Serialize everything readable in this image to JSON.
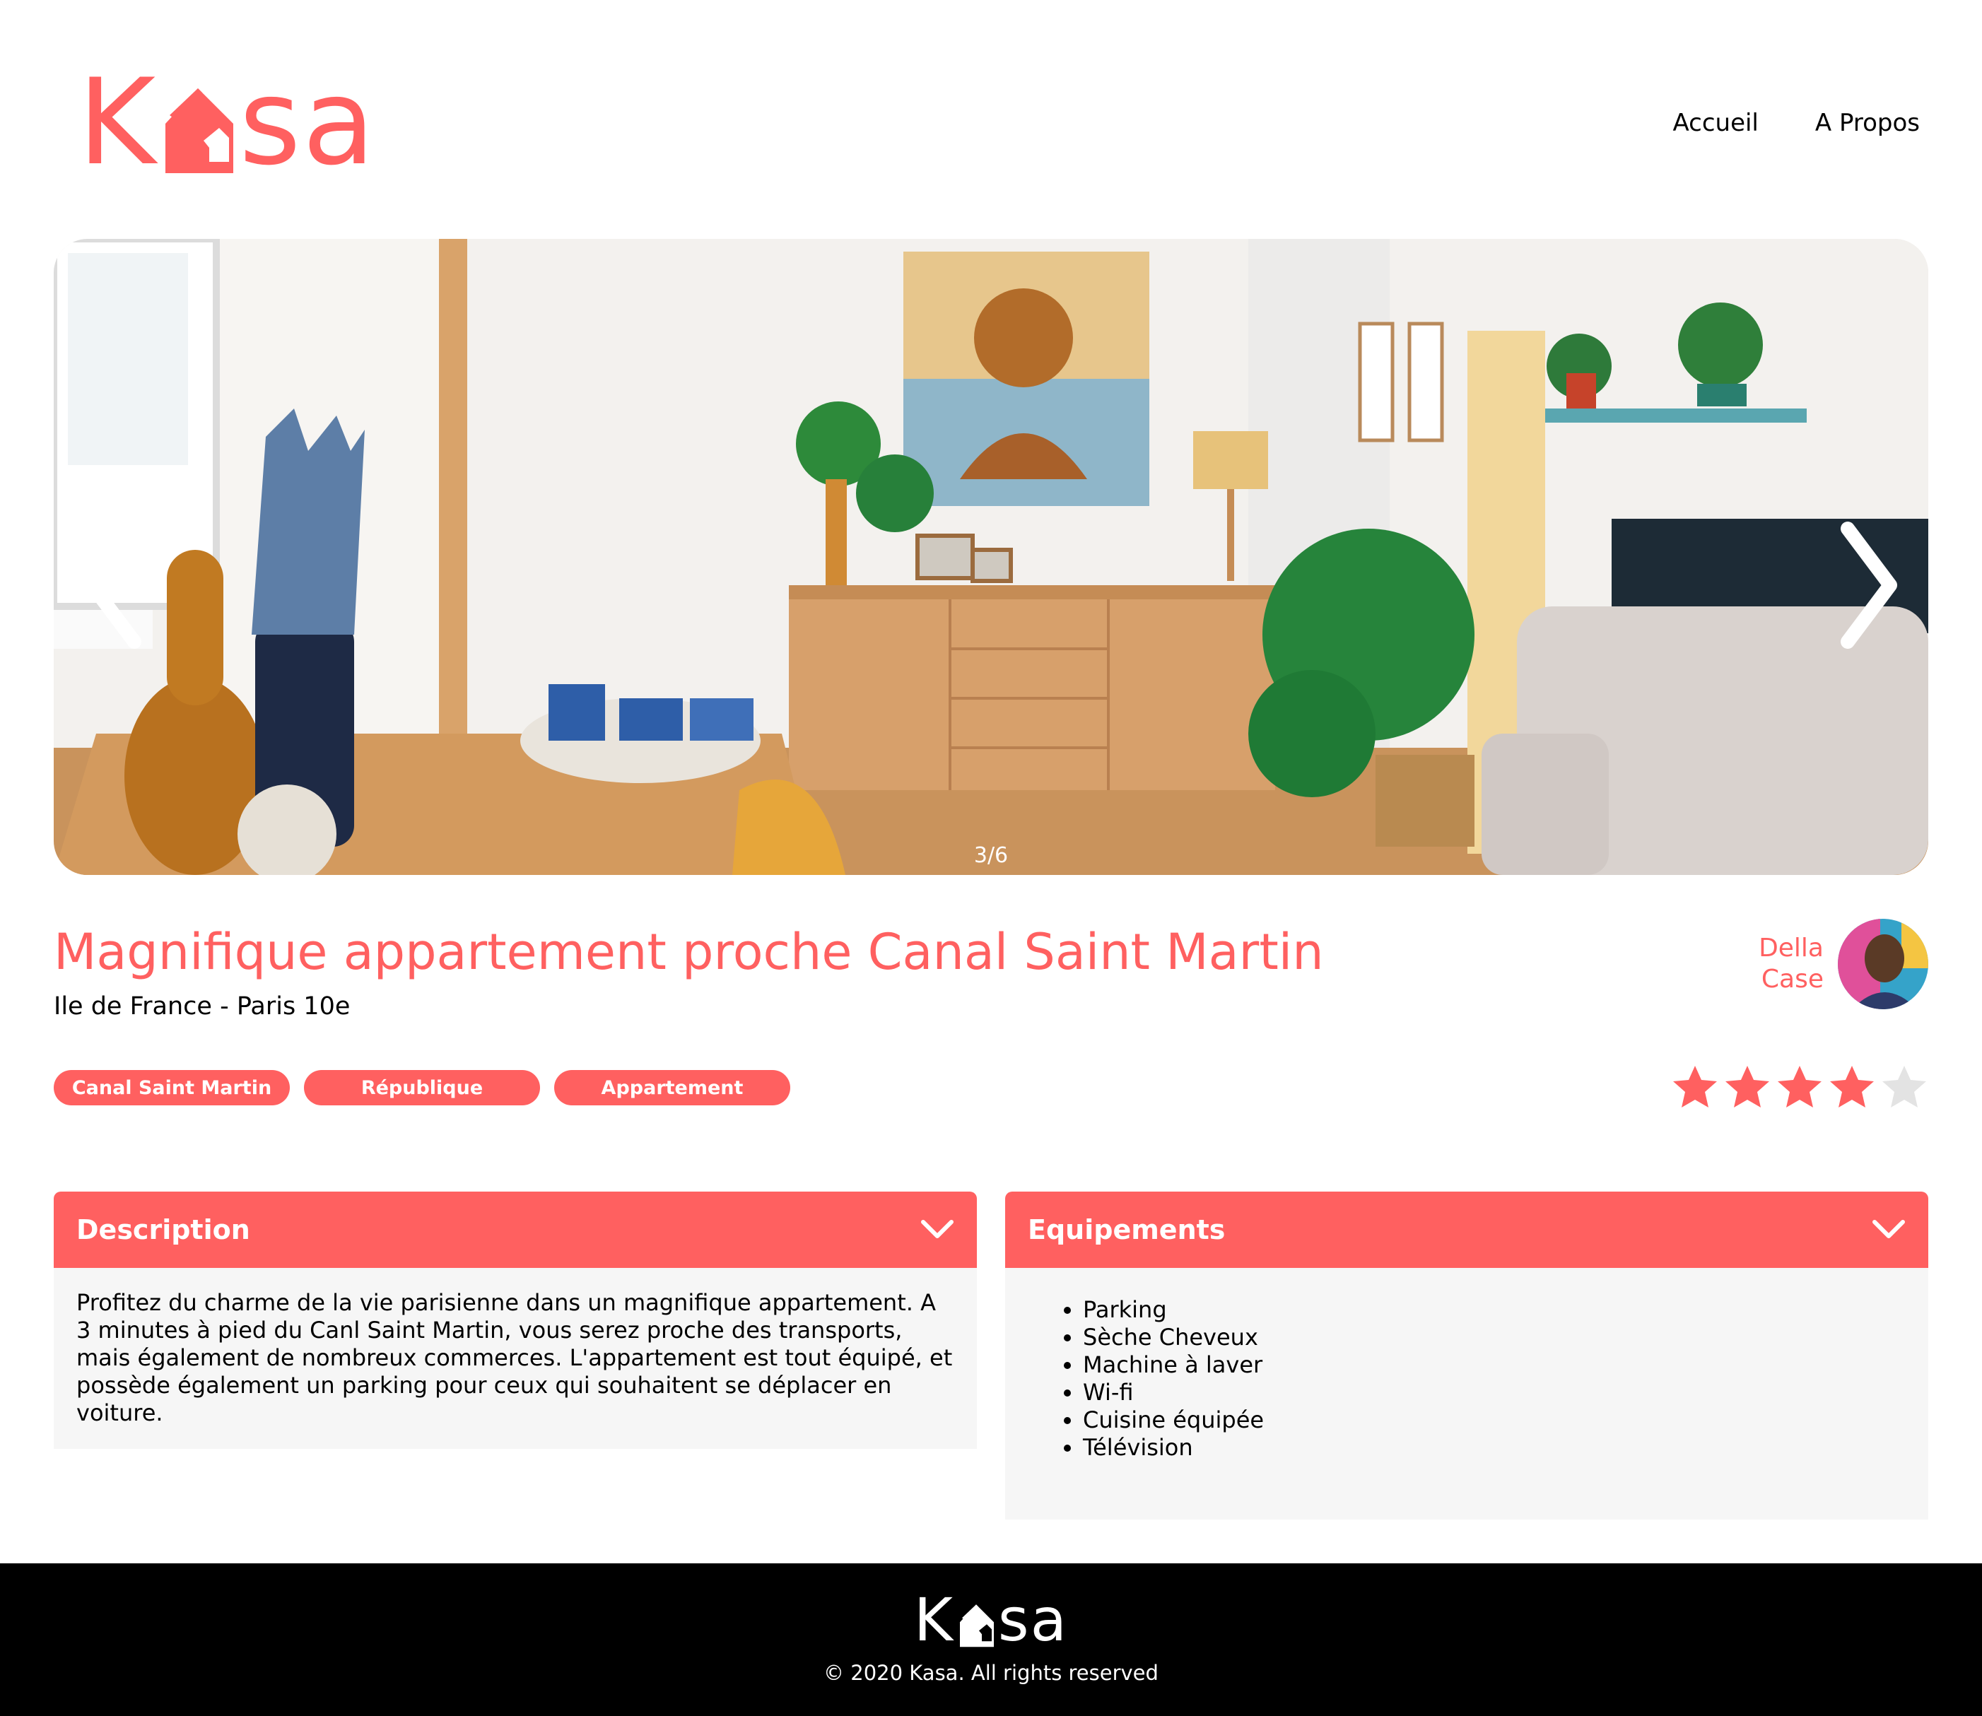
{
  "brand": {
    "logo_before": "K",
    "logo_after": "sa",
    "accent_color": "#FF6060"
  },
  "nav": {
    "home": "Accueil",
    "about": "A Propos"
  },
  "gallery": {
    "counter": "3/6",
    "prev_icon": "chevron-left-icon",
    "next_icon": "chevron-right-icon"
  },
  "listing": {
    "title": "Magnifique appartement proche Canal Saint Martin",
    "location": "Ile de France - Paris 10e",
    "tags": [
      "Canal Saint Martin",
      "République",
      "Appartement"
    ],
    "host_first": "Della",
    "host_last": "Case",
    "rating": 4,
    "rating_max": 5
  },
  "description": {
    "title": "Description",
    "text": "Profitez du charme de la vie parisienne dans un magnifique appartement. A 3 minutes à pied du Canl Saint Martin, vous serez proche des transports, mais également de nombreux commerces. L'appartement est tout équipé, et possède également un parking pour ceux qui souhaitent se déplacer en voiture."
  },
  "equipments": {
    "title": "Equipements",
    "items": [
      "Parking",
      "Sèche Cheveux",
      "Machine à laver",
      "Wi-fi",
      "Cuisine équipée",
      "Télévision"
    ]
  },
  "footer": {
    "copyright": "© 2020 Kasa. All rights reserved"
  }
}
